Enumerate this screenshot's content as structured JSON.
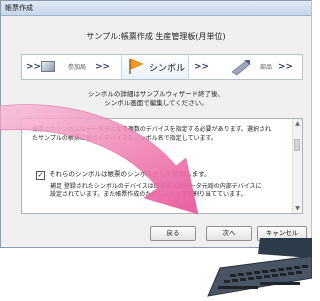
{
  "window": {
    "title": "帳票作成",
    "header": "サンプル:帳票作成 生産管理板(月単位)"
  },
  "steps": [
    {
      "label": "参加局",
      "arrow": ">>"
    },
    {
      "label": "シンボル",
      "arrow": ">>",
      "current": true
    },
    {
      "label": "部品",
      "arrow": ">>"
    }
  ],
  "instruction": {
    "line1": "シンボルの詳細はサンプルウィザード終了後、",
    "line2": "シンボル画面で編集してください。"
  },
  "content": {
    "desc_line1": "帳票上のシンボルはデータ元となる複数のデバイスを指定する必要があります。選択され",
    "desc_line2": "たサンプルの帳票に基づくデバイスをシンボル名で指定しています。",
    "checkbox": {
      "checked": true,
      "label": "それらのシンボルは帳票のシンボルとして登録します。"
    },
    "note_line1": "補足 登録されたシンボルのデバイスは回帳表ではデータ元局の内部デバイスに",
    "note_line2": "設定されています。また帳票作成のためにデバイスを割り当てています。"
  },
  "buttons": {
    "back": "戻る",
    "next": "次へ",
    "cancel": "キャンセル"
  },
  "colors": {
    "accent_arrow": "#e8559a",
    "step_arrow": "#2f3f6f"
  }
}
